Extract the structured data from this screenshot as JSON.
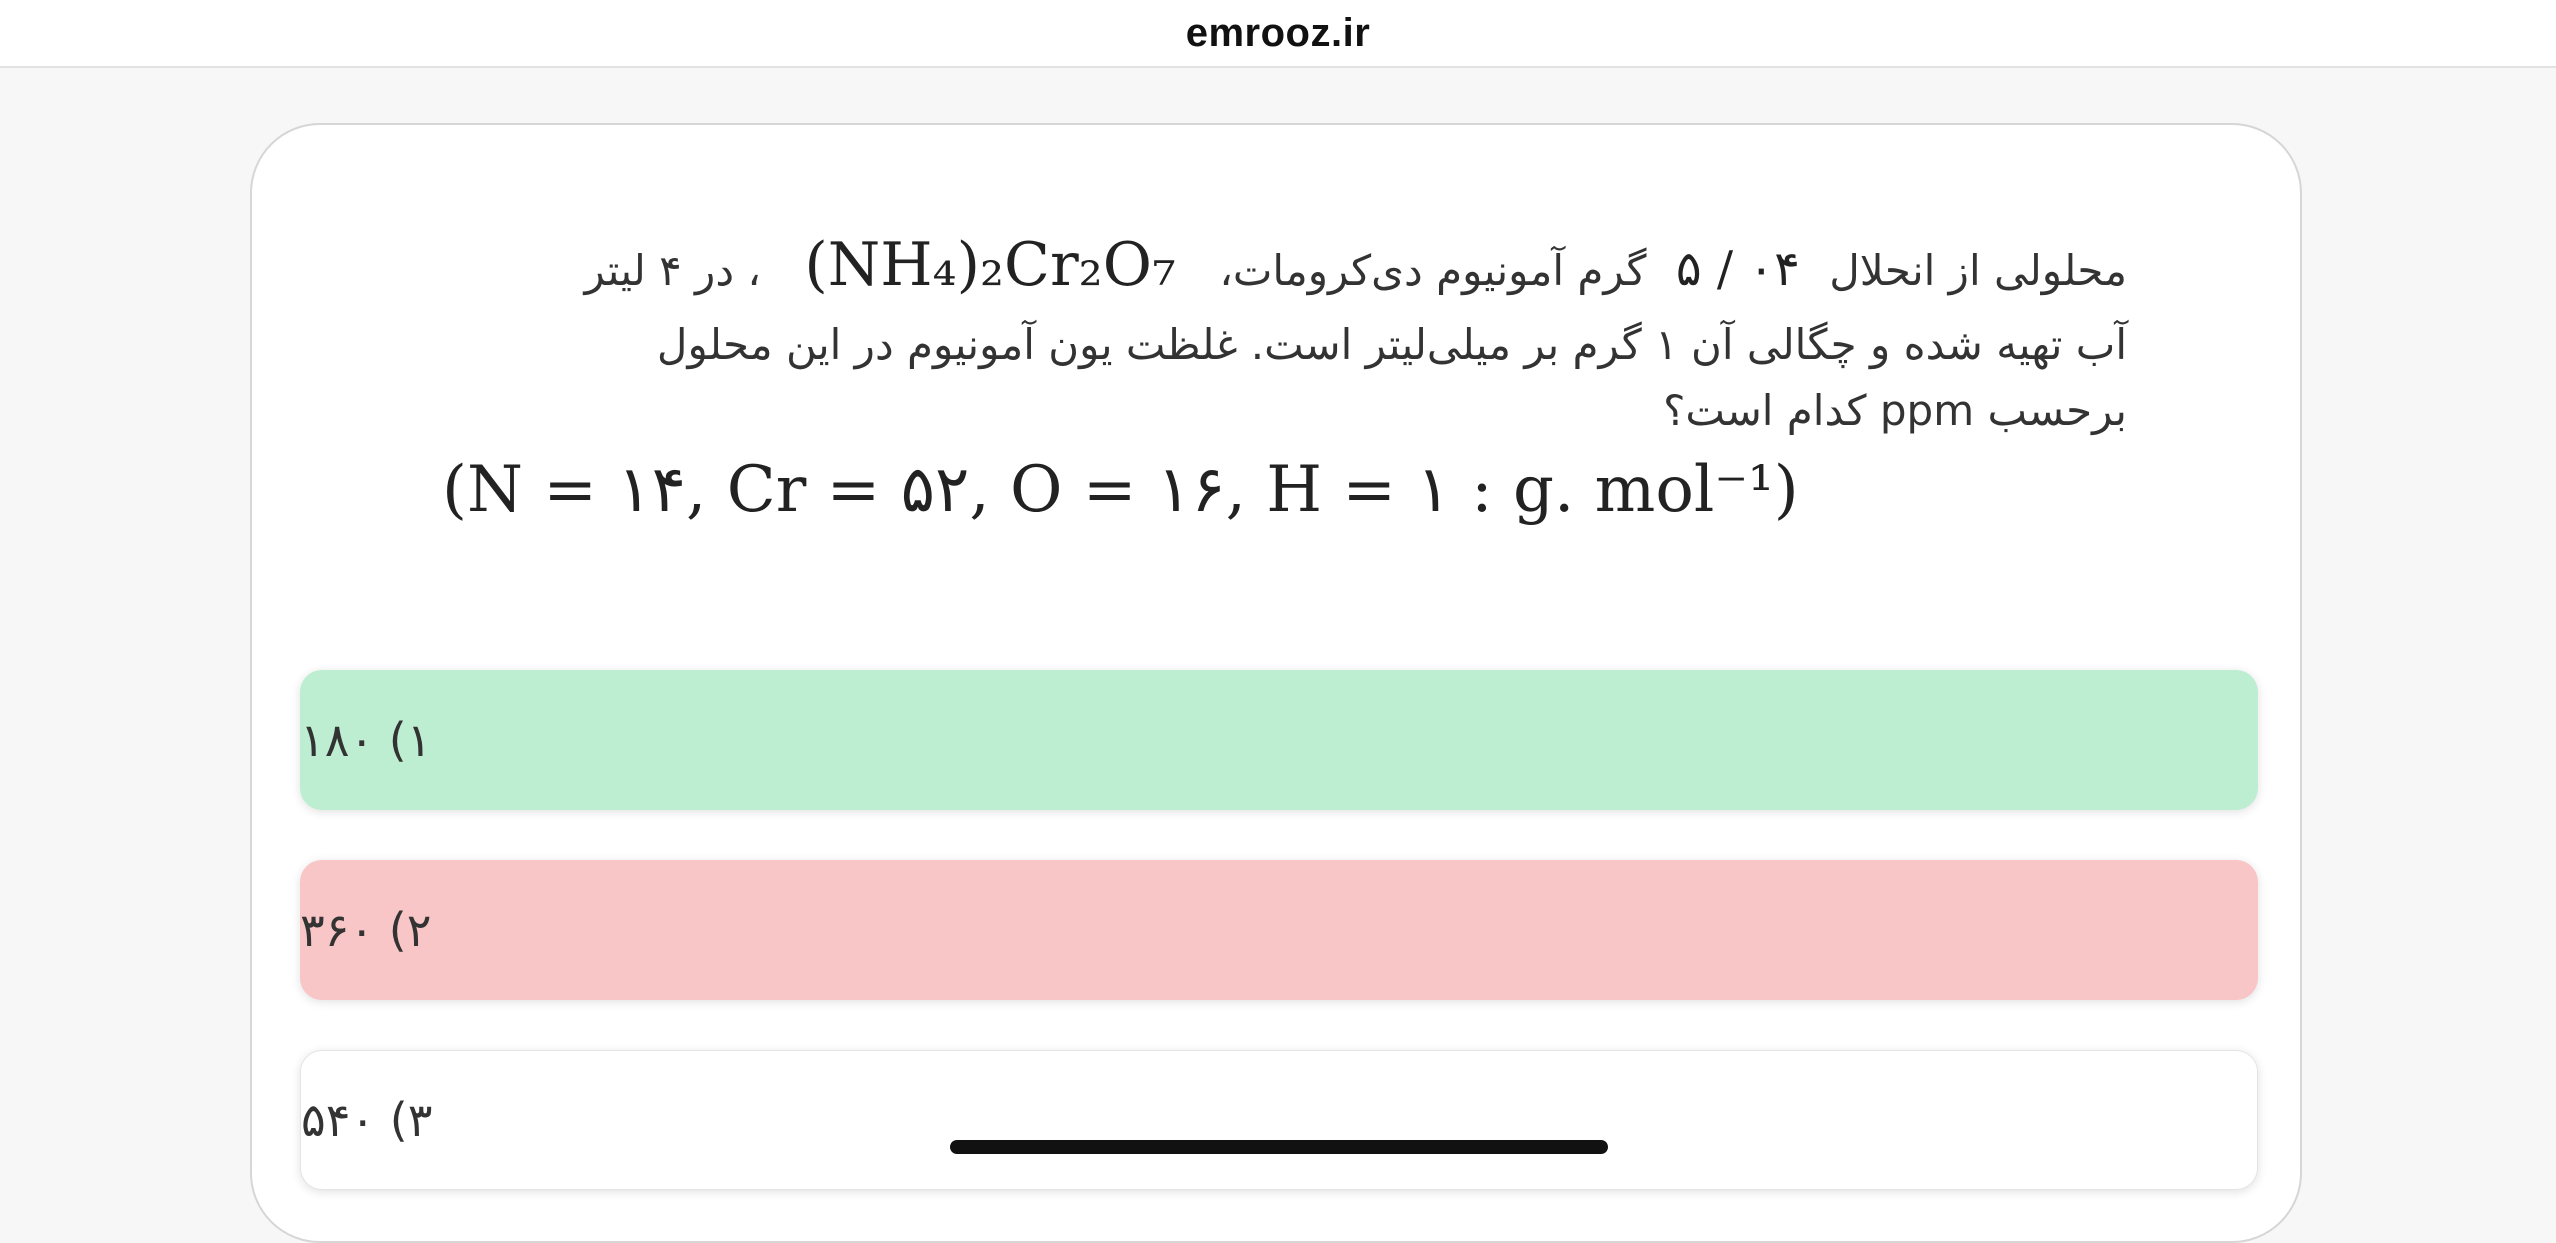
{
  "site": {
    "domain": "emrooz.ir"
  },
  "question": {
    "line1_before": "محلولی از انحلال",
    "amount": "۵ / ۰۴",
    "line1_middle": "گرم آمونیوم دی‌کرومات،",
    "formula_text": "(NH₄)₂Cr₂O₇",
    "line1_after": "، در ۴ لیتر",
    "line2": "آب تهیه شده و چگالی آن ۱ گرم بر میلی‌لیتر است. غلظت یون آمونیوم در این محلول",
    "line3": "برحسب ppm کدام است؟",
    "atomic_masses": "(N = ۱۴, Cr = ۵۲, O = ۱۶, H = ۱ : g. mol⁻¹)"
  },
  "options": [
    {
      "label": "۱) ۱۸۰",
      "state": "correct",
      "color": "#bdeed1"
    },
    {
      "label": "۲) ۳۶۰",
      "state": "wrong",
      "color": "#f8c6c7"
    },
    {
      "label": "۳) ۵۴۰",
      "state": "neutral",
      "color": "#ffffff"
    }
  ]
}
